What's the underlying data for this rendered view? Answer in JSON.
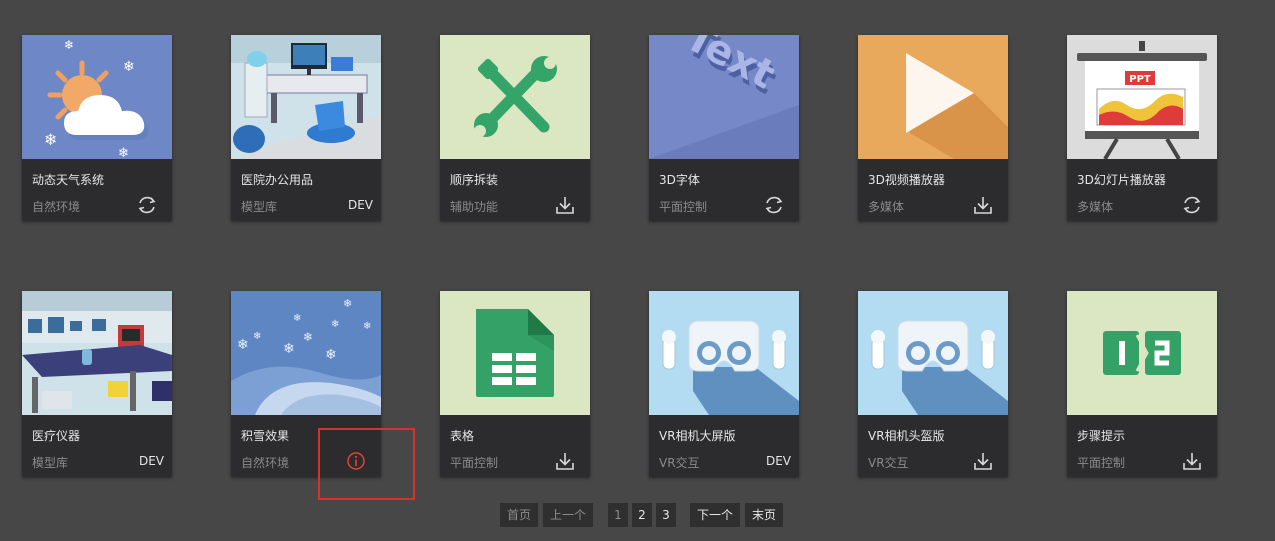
{
  "cards": [
    {
      "title": "动态天气系统",
      "category": "自然环境",
      "status_icon": "sync-icon",
      "status_text": "",
      "thumb_bg": "#6e87c6"
    },
    {
      "title": "医院办公用品",
      "category": "模型库",
      "status_icon": "",
      "status_text": "DEV",
      "thumb_bg": "#cfe2ea"
    },
    {
      "title": "顺序拆装",
      "category": "辅助功能",
      "status_icon": "download-icon",
      "status_text": "",
      "thumb_bg": "#dbe6c2"
    },
    {
      "title": "3D字体",
      "category": "平面控制",
      "status_icon": "sync-icon",
      "status_text": "",
      "thumb_bg": "#7688c8"
    },
    {
      "title": "3D视频播放器",
      "category": "多媒体",
      "status_icon": "download-icon",
      "status_text": "",
      "thumb_bg": "#e8a95c"
    },
    {
      "title": "3D幻灯片播放器",
      "category": "多媒体",
      "status_icon": "sync-icon",
      "status_text": "",
      "thumb_bg": "#dcdcdc",
      "thumb_label": "PPT"
    },
    {
      "title": "医疗仪器",
      "category": "模型库",
      "status_icon": "",
      "status_text": "DEV",
      "thumb_bg": "#cfe2ea"
    },
    {
      "title": "积雪效果",
      "category": "自然环境",
      "status_icon": "info-icon",
      "status_text": "",
      "thumb_bg": "#5e86c2"
    },
    {
      "title": "表格",
      "category": "平面控制",
      "status_icon": "download-icon",
      "status_text": "",
      "thumb_bg": "#dbe6c2"
    },
    {
      "title": "VR相机大屏版",
      "category": "VR交互",
      "status_icon": "",
      "status_text": "DEV",
      "thumb_bg": "#b3dcf2"
    },
    {
      "title": "VR相机头盔版",
      "category": "VR交互",
      "status_icon": "download-icon",
      "status_text": "",
      "thumb_bg": "#b3dcf2"
    },
    {
      "title": "步骤提示",
      "category": "平面控制",
      "status_icon": "download-icon",
      "status_text": "",
      "thumb_bg": "#dbe6c2"
    }
  ],
  "colors": {
    "accent_red": "#e0433b",
    "icon_gray": "#d8d8d8"
  },
  "pagination": {
    "first": "首页",
    "prev": "上一个",
    "pages": [
      "1",
      "2",
      "3"
    ],
    "next": "下一个",
    "last": "末页"
  }
}
